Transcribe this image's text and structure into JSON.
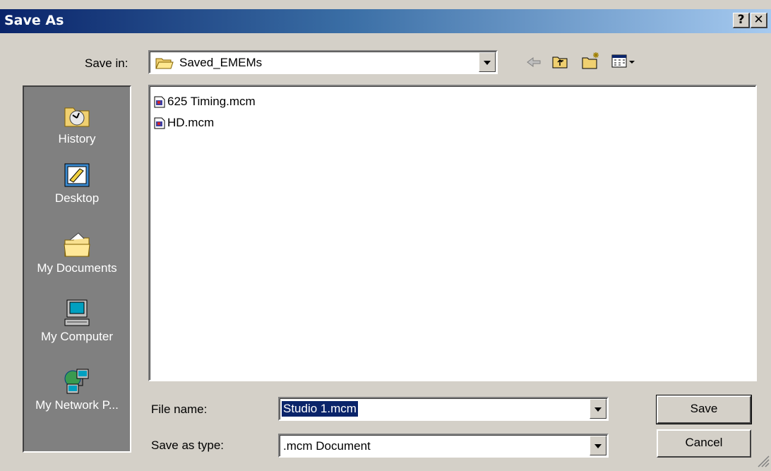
{
  "dialog": {
    "title": "Save As",
    "help_label": "?",
    "close_label": "✕"
  },
  "save_in": {
    "label": "Save in:",
    "value": "Saved_EMEMs"
  },
  "places": [
    {
      "label": "History",
      "icon": "history-icon"
    },
    {
      "label": "Desktop",
      "icon": "desktop-icon"
    },
    {
      "label": "My Documents",
      "icon": "my-documents-icon"
    },
    {
      "label": "My Computer",
      "icon": "my-computer-icon"
    },
    {
      "label": "My Network P...",
      "icon": "my-network-places-icon"
    }
  ],
  "files": [
    {
      "name": "625 Timing.mcm",
      "icon": "mcm-file-icon"
    },
    {
      "name": "HD.mcm",
      "icon": "mcm-file-icon"
    }
  ],
  "file_name": {
    "label": "File name:",
    "value": "Studio 1.mcm"
  },
  "save_as_type": {
    "label": "Save as type:",
    "value": ".mcm Document"
  },
  "buttons": {
    "save": "Save",
    "cancel": "Cancel"
  },
  "colors": {
    "title_start": "#0a246a",
    "title_end": "#a6caf0",
    "selection": "#0a246a",
    "face": "#d4d0c8"
  }
}
